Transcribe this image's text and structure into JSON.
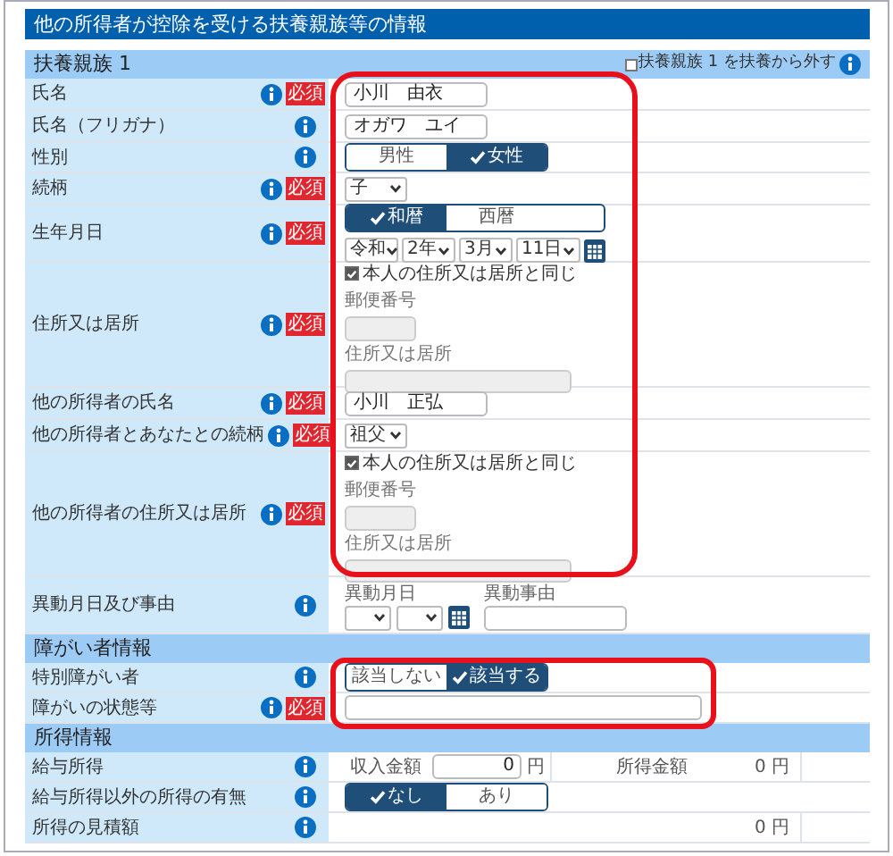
{
  "title": "他の所得者が控除を受ける扶養親族等の情報",
  "sections": [
    {
      "heading": "扶養親族 1",
      "exclude_option": {
        "label": "扶養親族 1 を扶養から外す",
        "checked": false
      },
      "rows": [
        {
          "kind": "text",
          "label": "氏名",
          "required": "必須",
          "value": "小川　由衣"
        },
        {
          "kind": "text",
          "label": "氏名（フリガナ）",
          "value": "オガワ　ユイ"
        },
        {
          "kind": "toggle",
          "label": "性別",
          "options": [
            {
              "label": "男性",
              "selected": false
            },
            {
              "label": "女性",
              "selected": true
            }
          ]
        },
        {
          "kind": "select",
          "label": "続柄",
          "required": "必須",
          "value": "子"
        },
        {
          "kind": "date",
          "label": "生年月日",
          "required": "必須",
          "options": [
            {
              "label": "和暦",
              "selected": true
            },
            {
              "label": "西暦",
              "selected": false
            }
          ],
          "selects": [
            "令和",
            "2年",
            "3月",
            "11日"
          ]
        },
        {
          "kind": "address",
          "label": "住所又は居所",
          "required": "必須",
          "same": {
            "label": "本人の住所又は居所と同じ",
            "checked": true
          },
          "postal_label": "郵便番号",
          "address_label": "住所又は居所"
        },
        {
          "kind": "text",
          "label": "他の所得者の氏名",
          "required": "必須",
          "value": "小川　正弘"
        },
        {
          "kind": "select",
          "label": "他の所得者とあなたとの続柄",
          "required": "必須",
          "value": "祖父"
        },
        {
          "kind": "address",
          "label": "他の所得者の住所又は居所",
          "required": "必須",
          "same": {
            "label": "本人の住所又は居所と同じ",
            "checked": true
          },
          "postal_label": "郵便番号",
          "address_label": "住所又は居所"
        },
        {
          "kind": "change",
          "label": "異動月日及び事由",
          "date_label": "異動月日",
          "reason_label": "異動事由"
        }
      ]
    },
    {
      "heading": "障がい者情報",
      "rows": [
        {
          "kind": "toggle",
          "label": "特別障がい者",
          "options": [
            {
              "label": "該当しない",
              "selected": false
            },
            {
              "label": "該当する",
              "selected": true
            }
          ]
        },
        {
          "kind": "wide_text",
          "label": "障がいの状態等",
          "required": "必須"
        }
      ]
    },
    {
      "heading": "所得情報",
      "rows": [
        {
          "kind": "income",
          "label": "給与所得",
          "income_label": "収入金額",
          "income_value": "0",
          "unit": "円",
          "result_label": "所得金額",
          "result_value": "0",
          "result_unit": "円"
        },
        {
          "kind": "toggle",
          "label": "給与所得以外の所得の有無",
          "options": [
            {
              "label": "なし",
              "selected": true
            },
            {
              "label": "あり",
              "selected": false
            }
          ]
        },
        {
          "kind": "amount",
          "label": "所得の見積額",
          "value": "0",
          "unit": "円"
        }
      ]
    }
  ]
}
